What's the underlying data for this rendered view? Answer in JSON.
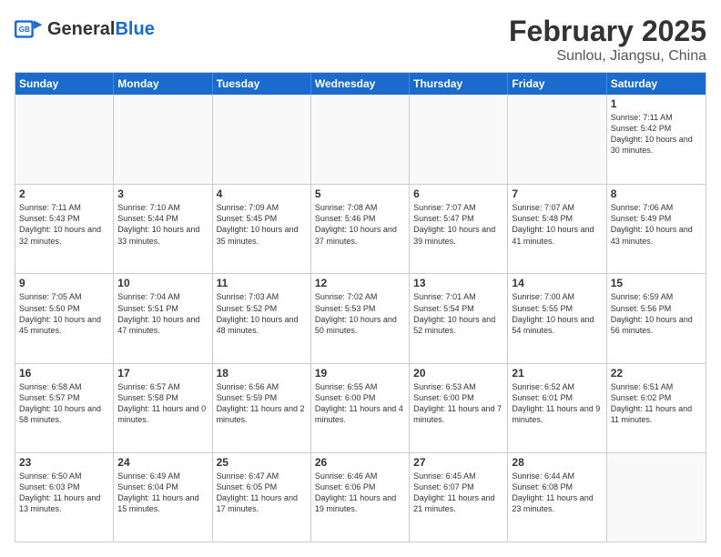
{
  "header": {
    "logo_general": "General",
    "logo_blue": "Blue",
    "month_title": "February 2025",
    "location": "Sunlou, Jiangsu, China"
  },
  "calendar": {
    "days_of_week": [
      "Sunday",
      "Monday",
      "Tuesday",
      "Wednesday",
      "Thursday",
      "Friday",
      "Saturday"
    ],
    "weeks": [
      [
        {
          "day": "",
          "info": ""
        },
        {
          "day": "",
          "info": ""
        },
        {
          "day": "",
          "info": ""
        },
        {
          "day": "",
          "info": ""
        },
        {
          "day": "",
          "info": ""
        },
        {
          "day": "",
          "info": ""
        },
        {
          "day": "1",
          "info": "Sunrise: 7:11 AM\nSunset: 5:42 PM\nDaylight: 10 hours and 30 minutes."
        }
      ],
      [
        {
          "day": "2",
          "info": "Sunrise: 7:11 AM\nSunset: 5:43 PM\nDaylight: 10 hours and 32 minutes."
        },
        {
          "day": "3",
          "info": "Sunrise: 7:10 AM\nSunset: 5:44 PM\nDaylight: 10 hours and 33 minutes."
        },
        {
          "day": "4",
          "info": "Sunrise: 7:09 AM\nSunset: 5:45 PM\nDaylight: 10 hours and 35 minutes."
        },
        {
          "day": "5",
          "info": "Sunrise: 7:08 AM\nSunset: 5:46 PM\nDaylight: 10 hours and 37 minutes."
        },
        {
          "day": "6",
          "info": "Sunrise: 7:07 AM\nSunset: 5:47 PM\nDaylight: 10 hours and 39 minutes."
        },
        {
          "day": "7",
          "info": "Sunrise: 7:07 AM\nSunset: 5:48 PM\nDaylight: 10 hours and 41 minutes."
        },
        {
          "day": "8",
          "info": "Sunrise: 7:06 AM\nSunset: 5:49 PM\nDaylight: 10 hours and 43 minutes."
        }
      ],
      [
        {
          "day": "9",
          "info": "Sunrise: 7:05 AM\nSunset: 5:50 PM\nDaylight: 10 hours and 45 minutes."
        },
        {
          "day": "10",
          "info": "Sunrise: 7:04 AM\nSunset: 5:51 PM\nDaylight: 10 hours and 47 minutes."
        },
        {
          "day": "11",
          "info": "Sunrise: 7:03 AM\nSunset: 5:52 PM\nDaylight: 10 hours and 48 minutes."
        },
        {
          "day": "12",
          "info": "Sunrise: 7:02 AM\nSunset: 5:53 PM\nDaylight: 10 hours and 50 minutes."
        },
        {
          "day": "13",
          "info": "Sunrise: 7:01 AM\nSunset: 5:54 PM\nDaylight: 10 hours and 52 minutes."
        },
        {
          "day": "14",
          "info": "Sunrise: 7:00 AM\nSunset: 5:55 PM\nDaylight: 10 hours and 54 minutes."
        },
        {
          "day": "15",
          "info": "Sunrise: 6:59 AM\nSunset: 5:56 PM\nDaylight: 10 hours and 56 minutes."
        }
      ],
      [
        {
          "day": "16",
          "info": "Sunrise: 6:58 AM\nSunset: 5:57 PM\nDaylight: 10 hours and 58 minutes."
        },
        {
          "day": "17",
          "info": "Sunrise: 6:57 AM\nSunset: 5:58 PM\nDaylight: 11 hours and 0 minutes."
        },
        {
          "day": "18",
          "info": "Sunrise: 6:56 AM\nSunset: 5:59 PM\nDaylight: 11 hours and 2 minutes."
        },
        {
          "day": "19",
          "info": "Sunrise: 6:55 AM\nSunset: 6:00 PM\nDaylight: 11 hours and 4 minutes."
        },
        {
          "day": "20",
          "info": "Sunrise: 6:53 AM\nSunset: 6:00 PM\nDaylight: 11 hours and 7 minutes."
        },
        {
          "day": "21",
          "info": "Sunrise: 6:52 AM\nSunset: 6:01 PM\nDaylight: 11 hours and 9 minutes."
        },
        {
          "day": "22",
          "info": "Sunrise: 6:51 AM\nSunset: 6:02 PM\nDaylight: 11 hours and 11 minutes."
        }
      ],
      [
        {
          "day": "23",
          "info": "Sunrise: 6:50 AM\nSunset: 6:03 PM\nDaylight: 11 hours and 13 minutes."
        },
        {
          "day": "24",
          "info": "Sunrise: 6:49 AM\nSunset: 6:04 PM\nDaylight: 11 hours and 15 minutes."
        },
        {
          "day": "25",
          "info": "Sunrise: 6:47 AM\nSunset: 6:05 PM\nDaylight: 11 hours and 17 minutes."
        },
        {
          "day": "26",
          "info": "Sunrise: 6:46 AM\nSunset: 6:06 PM\nDaylight: 11 hours and 19 minutes."
        },
        {
          "day": "27",
          "info": "Sunrise: 6:45 AM\nSunset: 6:07 PM\nDaylight: 11 hours and 21 minutes."
        },
        {
          "day": "28",
          "info": "Sunrise: 6:44 AM\nSunset: 6:08 PM\nDaylight: 11 hours and 23 minutes."
        },
        {
          "day": "",
          "info": ""
        }
      ]
    ]
  }
}
